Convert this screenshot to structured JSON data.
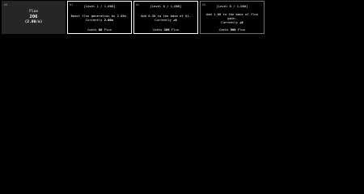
{
  "flux": {
    "tag": "#0",
    "label": "Flux",
    "value": "206",
    "rate": "(2.00/s)"
  },
  "upgrades": [
    {
      "tag": "#1",
      "level": "[Level 1 / 1,000]",
      "desc_line1": "Boost flux generation by 2.00x.",
      "desc_line2_prefix": "Currently ",
      "desc_line2_value": "2.00x",
      "cost_prefix": "Costs ",
      "cost_value": "88",
      "cost_suffix": " Flux"
    },
    {
      "tag": "#2",
      "level": "[Level 0 / 1,000]",
      "desc_line1": "Add 0.50 to the base of U1.",
      "desc_line2_prefix": "Currently ",
      "desc_line2_value": "+0",
      "cost_prefix": "Costs ",
      "cost_value": "100",
      "cost_suffix": " Flux"
    },
    {
      "tag": "#3",
      "level": "[Level 0 / 1,000]",
      "desc_line1": "Add 1.00 to the base of flux gain.",
      "desc_line2_prefix": "Currently ",
      "desc_line2_value": "+0",
      "cost_prefix": "Costs ",
      "cost_value": "500",
      "cost_suffix": " Flux"
    }
  ]
}
